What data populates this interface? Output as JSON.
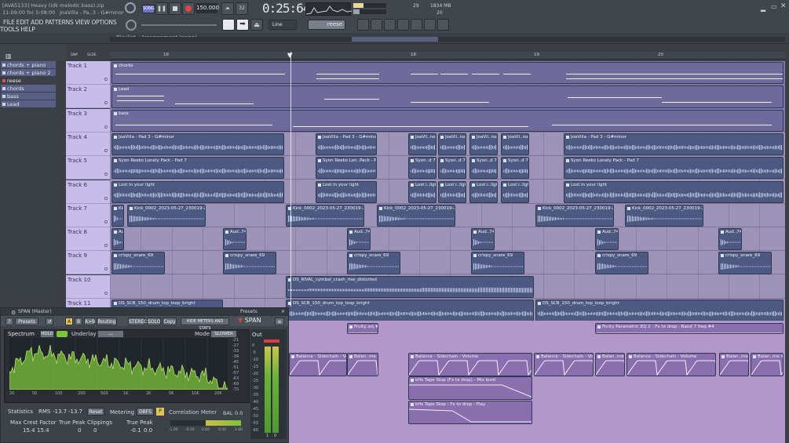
{
  "app": {
    "project_file": "[AVA5133] Heavy (idk melodic bass).zip",
    "datetime": "11:09:00 for 5:08:00",
    "song_info": "JoaVilla - Pa..3 - G#minor",
    "tempo": "150.000",
    "time_display": "0:25:64",
    "mem": "1834 MB",
    "cpu_val": "29",
    "poly": "20",
    "menu": [
      "FILE",
      "EDIT",
      "ADD",
      "PATTERNS",
      "VIEW",
      "OPTIONS",
      "TOOLS",
      "HELP"
    ],
    "snap": "Line",
    "channel": "reese"
  },
  "playlist": {
    "title": "Playlist - Arrangement",
    "pattern_label": "(none)",
    "ruler": [
      "16",
      "17",
      "18",
      "19",
      "20"
    ],
    "snap_label": "SNP",
    "slide_label": "SLDE"
  },
  "patterns": [
    "chords + piano",
    "chords + piano 2",
    "reese",
    "chords",
    "bass",
    "Lead"
  ],
  "tracks": [
    "Track 1",
    "Track 2",
    "Track 3",
    "Track 4",
    "Track 5",
    "Track 6",
    "Track 7",
    "Track 8",
    "Track 9",
    "Track 10",
    "Track 11"
  ],
  "clips": {
    "chords": "chords",
    "lead": "Lead",
    "bass": "bass",
    "pad": "JoaVilla - Pad 3 - G#minor",
    "pad_s": "JoaVill..minor",
    "pad_xs": "JoaVil..nor",
    "syon": "Syon Reeko Lonely Pack - Pad 7",
    "syon_m": "Syon Reeko Lon..Pack - Pad 7",
    "syon_s": "Syon..d 7",
    "lost": "Lost in your light",
    "lost_s": "Lost i..light",
    "kick": "Kick_0002_2023-05-27_230019-2",
    "aud": "Aud..744",
    "snare": "crispy_snare_69",
    "cymbal": "DS_RIVAL_cymbal_crash_rise_distorted",
    "loop": "DS_SCB_150_drum_top_loop_bright",
    "fruity_short": "Fruity..eq #3",
    "fruity": "Fruity Parametric EQ 2 - Fx to drop - Band 7 freq #4",
    "balance": "Balance - Sidechain - Volume",
    "balance_s": "Balan..me #2",
    "tape_mix": "kHs Tape Stop (Fx to drop) - Mix level",
    "tape_play": "kHs Tape Stop - Fx to drop - Play"
  },
  "span": {
    "title": "SPAN (Master)",
    "presets_label": "Presets",
    "buttons": {
      "presets": "Presets",
      "a": "A",
      "b": "B",
      "ab": "A>B",
      "routing": "Routing",
      "stereo": "STEREO",
      "solo": "SOLO",
      "copy": "Copy",
      "hide": "HIDE METERS AND STATS"
    },
    "logo": "SPAN",
    "spectrum": "Spectrum",
    "hold": "HOLD",
    "underlay": "Underlay",
    "underlay_val": "---",
    "mode": "Mode",
    "mode_val": "SLOWER",
    "out": "Out",
    "db_ticks": [
      "-21",
      "-27",
      "-33",
      "-39",
      "-45",
      "-51",
      "-57",
      "-63",
      "-69",
      "-75"
    ],
    "freq_ticks": [
      "20",
      "50",
      "100",
      "200",
      "500",
      "1K",
      "2K",
      "5K",
      "10K",
      "20K"
    ],
    "out_ticks": [
      "0",
      "-5",
      "-10",
      "-15",
      "-20",
      "-25",
      "-30",
      "-35",
      "-40",
      "-45",
      "-50",
      "-55",
      "-60"
    ],
    "stats": "Statistics",
    "rms": "RMS",
    "rms_l": "-13.7",
    "rms_r": "-13.7",
    "reset": "Reset",
    "metering": "Metering",
    "dbfs": "DBFS",
    "max_crest": "Max Crest Factor",
    "crest_l": "15.4",
    "crest_r": "15.4",
    "tp_clip": "True Peak Clippings",
    "tp_clip_l": "0",
    "tp_clip_r": "0",
    "true_peak": "True Peak",
    "tp_l": "-0.1",
    "tp_r": "0.0",
    "corr": "Correlation Meter",
    "bal": "BAL",
    "bal_val": "0.0",
    "corr_ticks": [
      "-1.00",
      "-0.50",
      "0.00",
      "0.50",
      "1.00"
    ],
    "meter_l": "1",
    "meter_r": "0"
  },
  "colors": {
    "accent": "#7a6fb0",
    "wave": "#c4d1ee",
    "spectrum": "#7cc43a"
  }
}
